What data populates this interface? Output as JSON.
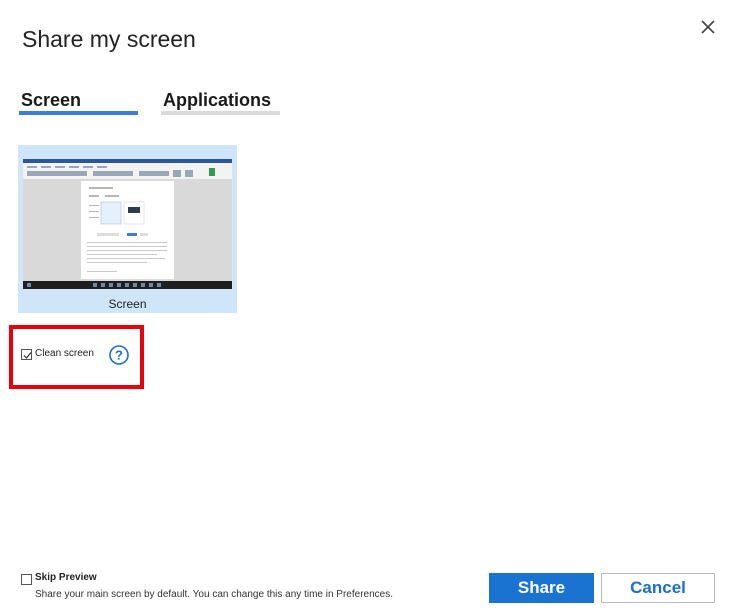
{
  "dialog": {
    "title": "Share my screen",
    "close_icon": "close-icon"
  },
  "tabs": [
    {
      "label": "Screen",
      "selected": true,
      "underline_color": "#3b7dd8"
    },
    {
      "label": "Applications",
      "selected": false,
      "underline_color": "#d9d9d9"
    }
  ],
  "screens": [
    {
      "label": "Screen",
      "selected": true
    }
  ],
  "clean_screen": {
    "label": "Clean screen",
    "checked": true,
    "help_icon": "help-circle-icon",
    "highlight_color": "#e8000b"
  },
  "skip_preview": {
    "label": "Skip Preview",
    "checked": false,
    "description": "Share your main screen by default. You can change this any time in Preferences."
  },
  "buttons": {
    "share": "Share",
    "cancel": "Cancel"
  },
  "colors": {
    "accent": "#1a73d0",
    "tile_bg": "#cfe5f8"
  }
}
